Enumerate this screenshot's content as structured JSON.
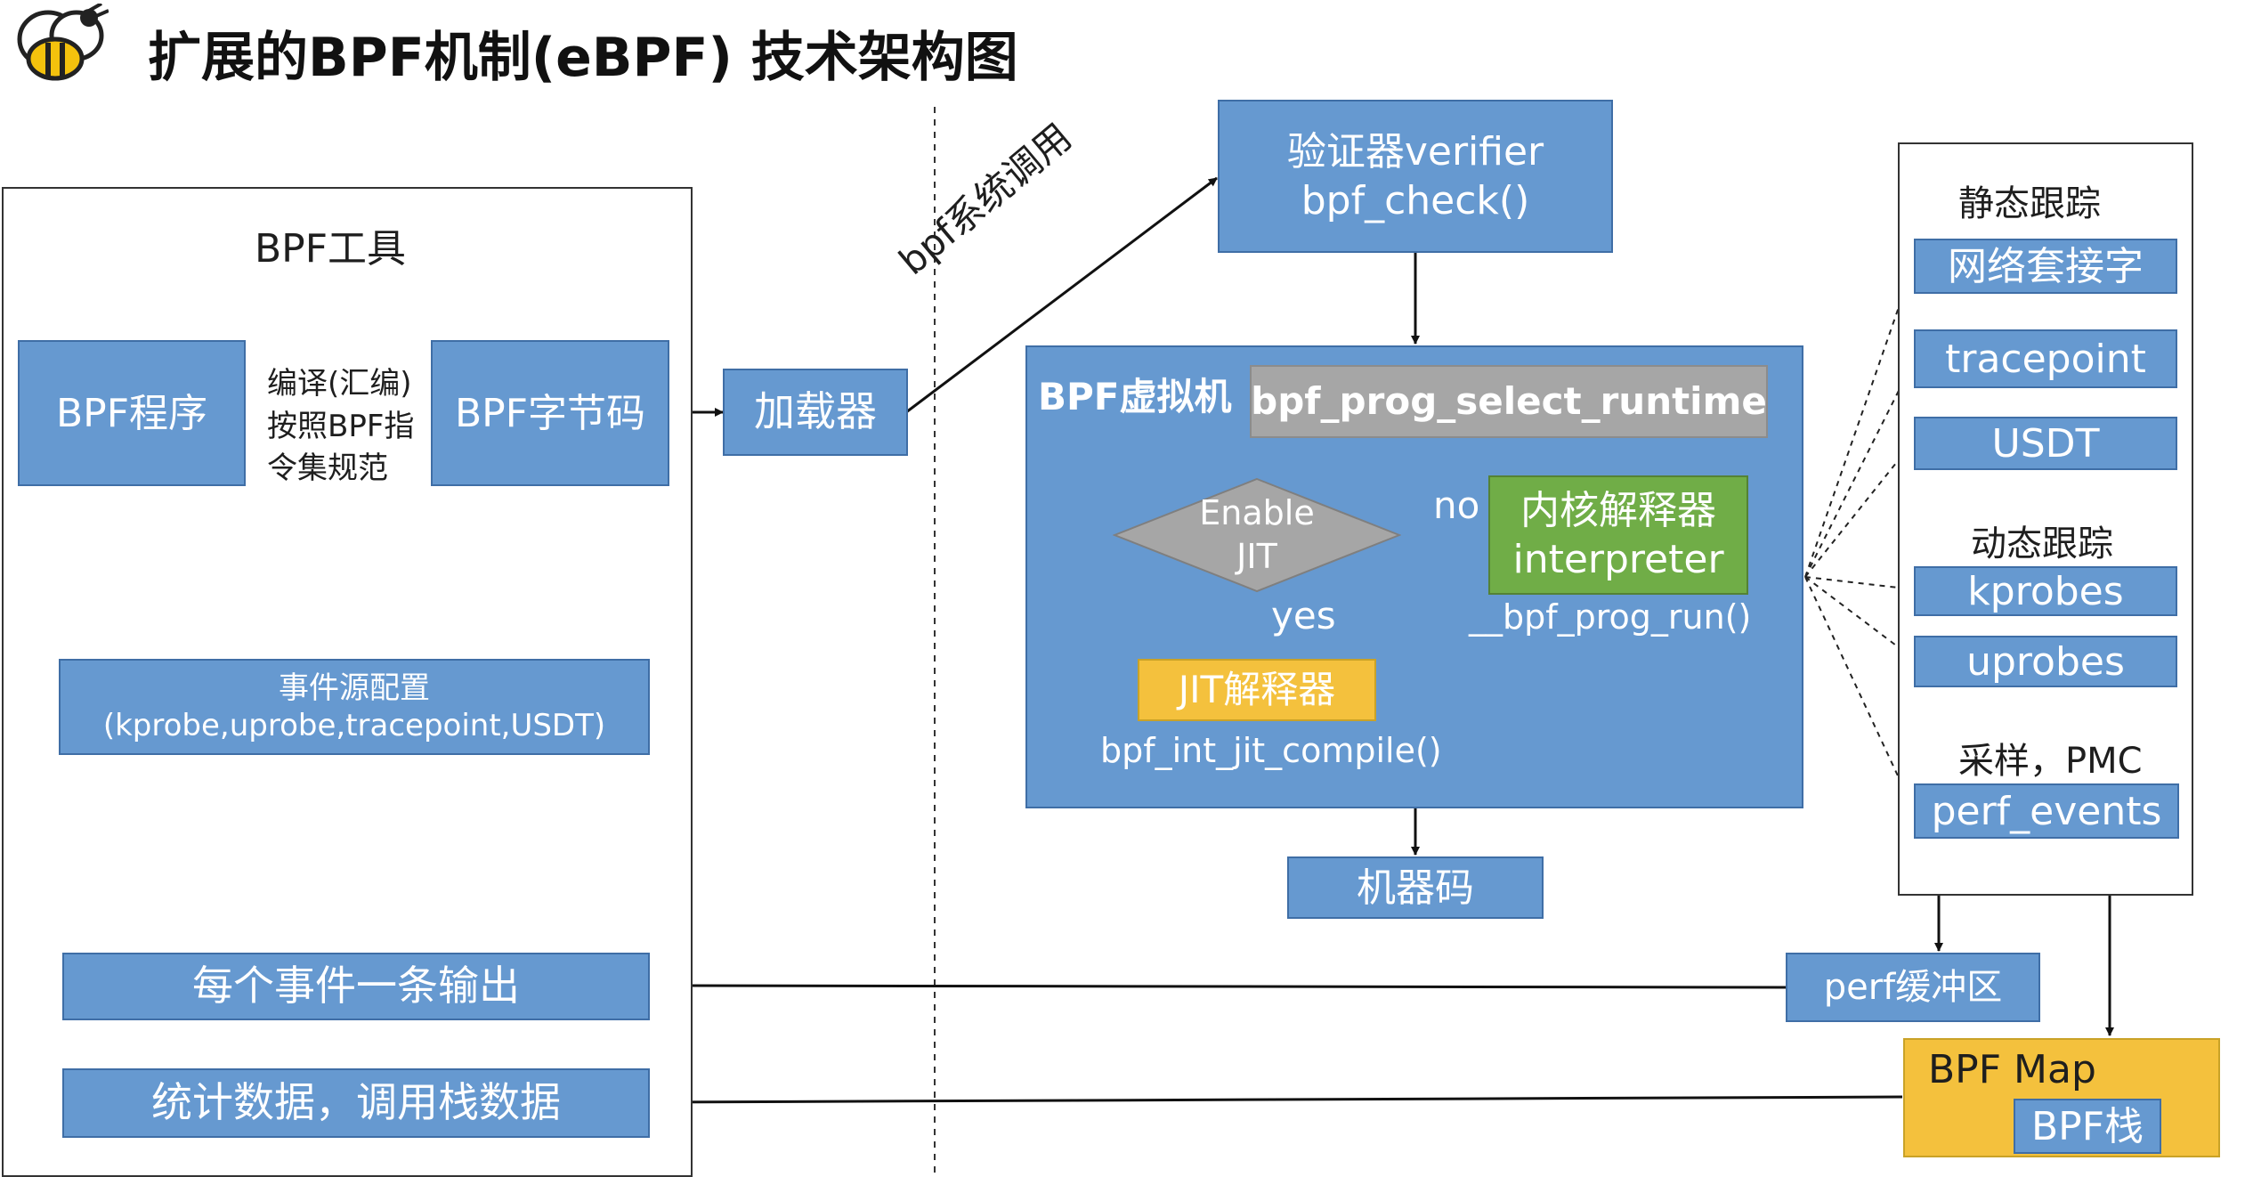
{
  "title": "扩展的BPF机制(eBPF) 技术架构图",
  "tools": {
    "heading": "BPF工具",
    "program": "BPF程序",
    "compile_label": "编译(汇编)\n按照BPF指\n令集规范",
    "bytecode": "BPF字节码",
    "event_config": "事件源配置\n(kprobe,uprobe,tracepoint,USDT)",
    "per_event_output": "每个事件一条输出",
    "stats_output": "统计数据，调用栈数据"
  },
  "loader": "加载器",
  "syscall_label": "bpf系统调用",
  "verifier": "验证器verifier\nbpf_check()",
  "vm": {
    "label": "BPF虚拟机",
    "select_runtime": "bpf_prog_select_runtime",
    "enable_jit": "Enable\nJIT",
    "no_label": "no",
    "yes_label": "yes",
    "interpreter": "内核解释器\ninterpreter",
    "bpf_prog_run": "__bpf_prog_run()",
    "jit": "JIT解释器",
    "jit_compile": "bpf_int_jit_compile()"
  },
  "machine_code": "机器码",
  "sources": {
    "static_heading": "静态跟踪",
    "socket": "网络套接字",
    "tracepoint": "tracepoint",
    "usdt": "USDT",
    "dynamic_heading": "动态跟踪",
    "kprobes": "kprobes",
    "uprobes": "uprobes",
    "sampling_heading": "采样，PMC",
    "perf_events": "perf_events"
  },
  "perf_buffer": "perf缓冲区",
  "bpf_map": "BPF Map",
  "bpf_stack": "BPF栈",
  "colors": {
    "blue_box": "#6699d0",
    "green_box": "#70ad47",
    "yellow_box": "#f4c13d",
    "gray_box": "#a6a6a6"
  }
}
